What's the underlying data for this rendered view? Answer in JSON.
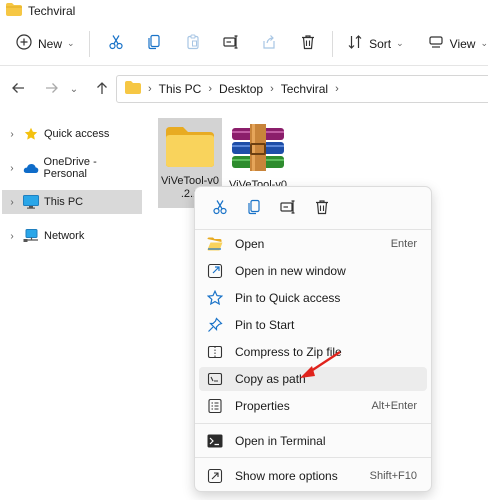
{
  "window": {
    "title": "Techviral"
  },
  "toolbar": {
    "new_label": "New",
    "sort_label": "Sort",
    "view_label": "View",
    "icons": [
      "cut-icon",
      "copy-icon",
      "paste-icon",
      "rename-icon",
      "share-icon",
      "delete-icon"
    ]
  },
  "address": {
    "crumbs": [
      "This PC",
      "Desktop",
      "Techviral"
    ]
  },
  "nav": {
    "items": [
      {
        "label": "Quick access",
        "icon": "star-icon"
      },
      {
        "label": "OneDrive - Personal",
        "icon": "cloud-icon"
      },
      {
        "label": "This PC",
        "icon": "monitor-icon",
        "selected": true
      },
      {
        "label": "Network",
        "icon": "network-icon"
      }
    ]
  },
  "files": [
    {
      "name": "ViVeTool-v0.2.1",
      "shown_name": "ViVeTool-v0\n.2.1",
      "type": "folder",
      "selected": true
    },
    {
      "name": "ViVeTool-v0",
      "shown_name": "ViVeTool-v0",
      "type": "winrar-archive"
    }
  ],
  "context_menu": {
    "quick_actions": [
      "cut-icon",
      "copy-icon",
      "rename-icon",
      "delete-icon"
    ],
    "items": [
      {
        "label": "Open",
        "shortcut": "Enter",
        "icon": "folder-open-icon"
      },
      {
        "label": "Open in new window",
        "shortcut": "",
        "icon": "new-window-icon"
      },
      {
        "label": "Pin to Quick access",
        "shortcut": "",
        "icon": "star-outline-icon"
      },
      {
        "label": "Pin to Start",
        "shortcut": "",
        "icon": "pin-icon"
      },
      {
        "label": "Compress to Zip file",
        "shortcut": "",
        "icon": "zip-icon"
      },
      {
        "label": "Copy as path",
        "shortcut": "",
        "icon": "copy-path-icon",
        "highlighted": true
      },
      {
        "label": "Properties",
        "shortcut": "Alt+Enter",
        "icon": "properties-icon"
      },
      {
        "label": "Open in Terminal",
        "shortcut": "",
        "icon": "terminal-icon"
      },
      {
        "label": "Show more options",
        "shortcut": "Shift+F10",
        "icon": "more-options-icon"
      }
    ]
  },
  "colors": {
    "accent": "#1a73c8",
    "folder": "#f6c744",
    "annotation": "#e0231c",
    "selection": "#d9d9d9"
  }
}
